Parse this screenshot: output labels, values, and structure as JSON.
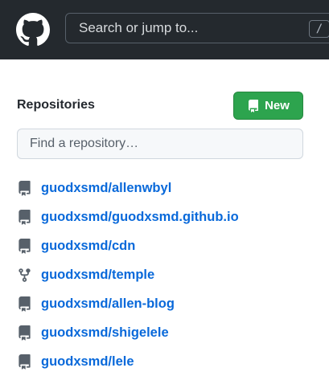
{
  "header": {
    "search_placeholder": "Search or jump to...",
    "slash_key": "/",
    "logo_icon": "github-octocat-icon",
    "background": "#24292e"
  },
  "sidebar": {
    "title": "Repositories",
    "new_button_label": "New",
    "new_button_icon": "repo-icon",
    "new_button_color": "#2da44e",
    "find_placeholder": "Find a repository…",
    "link_color": "#0969da",
    "repos": [
      {
        "name": "guodxsmd/allenwbyl",
        "icon": "repo-icon"
      },
      {
        "name": "guodxsmd/guodxsmd.github.io",
        "icon": "repo-icon"
      },
      {
        "name": "guodxsmd/cdn",
        "icon": "repo-icon"
      },
      {
        "name": "guodxsmd/temple",
        "icon": "fork-icon"
      },
      {
        "name": "guodxsmd/allen-blog",
        "icon": "repo-icon"
      },
      {
        "name": "guodxsmd/shigelele",
        "icon": "repo-icon"
      },
      {
        "name": "guodxsmd/lele",
        "icon": "repo-icon"
      }
    ]
  }
}
